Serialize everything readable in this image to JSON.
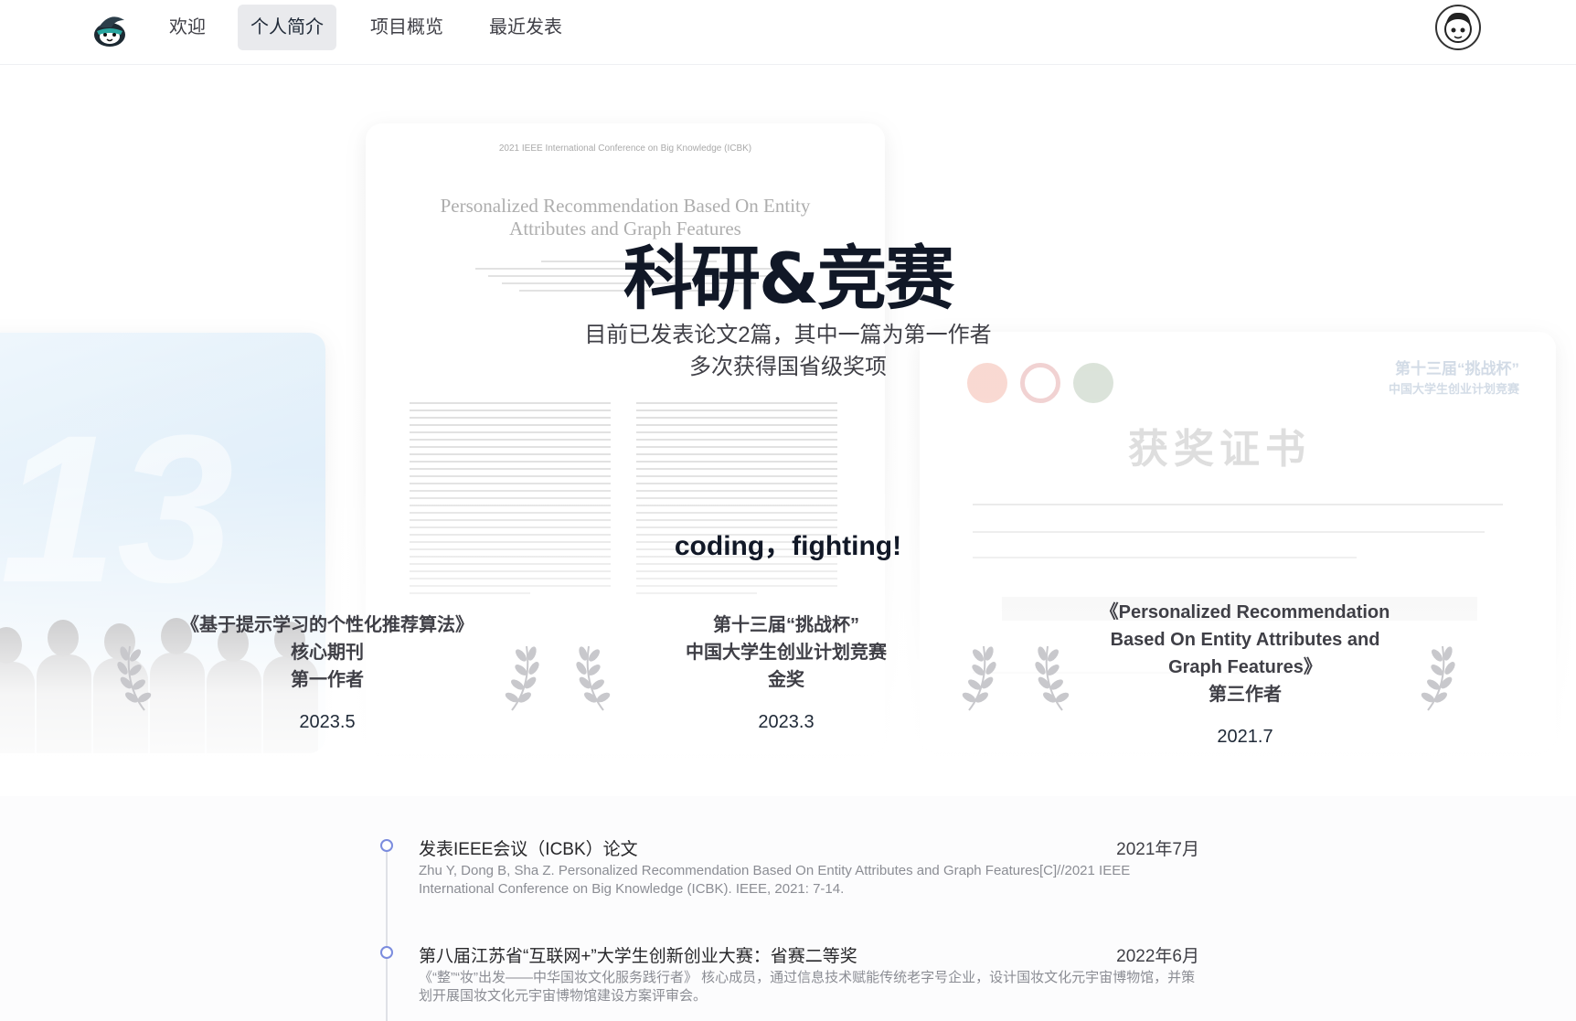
{
  "nav": {
    "logo_icon": "penguin-logo-icon",
    "items": [
      {
        "label": "欢迎",
        "active": false
      },
      {
        "label": "个人简介",
        "active": true
      },
      {
        "label": "项目概览",
        "active": false
      },
      {
        "label": "最近发表",
        "active": false
      }
    ],
    "avatar_icon": "cartoon-avatar-icon"
  },
  "hero": {
    "title": "科研&竞赛",
    "subtitle_lines": [
      "目前已发表论文2篇，其中一篇为第一作者",
      "多次获得国省级奖项"
    ],
    "motto": "coding，fighting!",
    "background_cards": {
      "paper": {
        "conference": "2021 IEEE International Conference on Big Knowledge (ICBK)",
        "title": "Personalized Recommendation Based On Entity Attributes and Graph Features"
      },
      "certificate": {
        "heading": "第十三届“挑战杯”",
        "subheading": "中国大学生创业计划竞赛",
        "title": "获奖证书"
      }
    },
    "awards": [
      {
        "lines": [
          "《基于提示学习的个性化推荐算法》",
          "核心期刊",
          "第一作者"
        ],
        "date": "2023.5"
      },
      {
        "lines": [
          "第十三届“挑战杯”",
          "中国大学生创业计划竞赛",
          "金奖"
        ],
        "date": "2023.3"
      },
      {
        "lines": [
          "《Personalized Recommendation",
          "Based On Entity Attributes and",
          "Graph Features》",
          "第三作者"
        ],
        "date": "2021.7"
      }
    ]
  },
  "timeline": [
    {
      "title": "发表IEEE会议（ICBK）论文",
      "date": "2021年7月",
      "desc": "Zhu Y, Dong B, Sha Z. Personalized Recommendation Based On Entity Attributes and Graph Features[C]//2021 IEEE International Conference on Big Knowledge (ICBK). IEEE, 2021: 7-14."
    },
    {
      "title": "第八届江苏省“互联网+”大学生创新创业大赛：省赛二等奖",
      "date": "2022年6月",
      "desc": "《“整”“妆”出发——中华国妆文化服务践行者》 核心成员，通过信息技术赋能传统老字号企业，设计国妆文化元宇宙博物馆，并策划开展国妆文化元宇宙博物馆建设方案评审会。"
    }
  ],
  "colors": {
    "accent": "#7b8cde",
    "nav_active_bg": "#e9eaed",
    "title": "#111827"
  }
}
